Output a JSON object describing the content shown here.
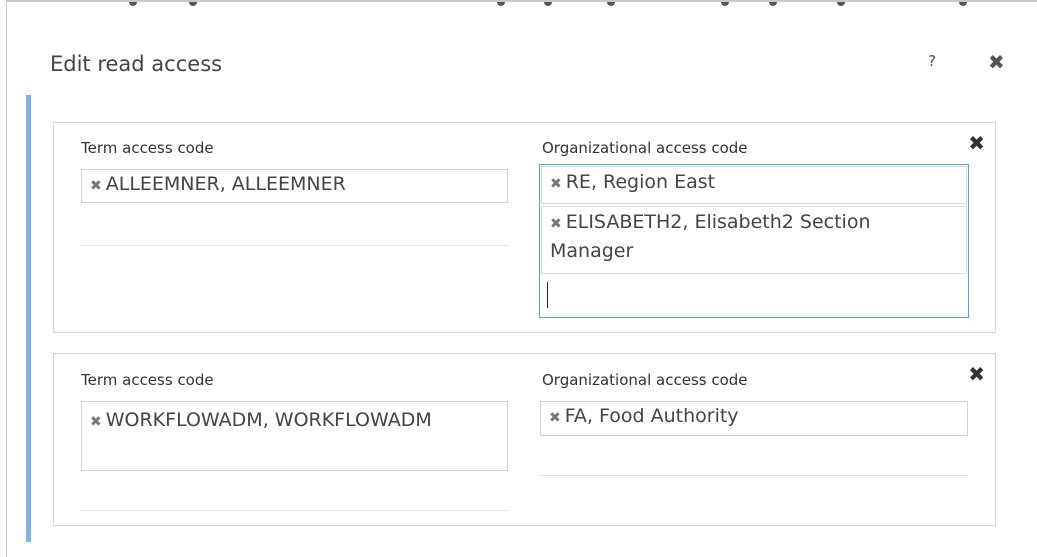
{
  "dialog": {
    "title": "Edit read access",
    "help_label": "?",
    "close_label": "✖"
  },
  "rows": [
    {
      "remove_label": "✖",
      "term": {
        "label": "Term access code",
        "tags": [
          {
            "x": "✖",
            "text": "ALLEEMNER, ALLEEMNER"
          }
        ]
      },
      "org": {
        "label": "Organizational access code",
        "tags": [
          {
            "x": "✖",
            "text": "RE, Region East"
          },
          {
            "x": "✖",
            "text": "ELISABETH2, Elisabeth2 Section Manager"
          }
        ]
      }
    },
    {
      "remove_label": "✖",
      "term": {
        "label": "Term access code",
        "tags": [
          {
            "x": "✖",
            "text": "WORKFLOWADM, WORKFLOWADM"
          }
        ]
      },
      "org": {
        "label": "Organizational access code",
        "tags": [
          {
            "x": "✖",
            "text": "FA, Food Authority"
          }
        ]
      }
    }
  ],
  "colors": {
    "accent": "#7fb3e3",
    "focus": "#4aa8e0"
  }
}
